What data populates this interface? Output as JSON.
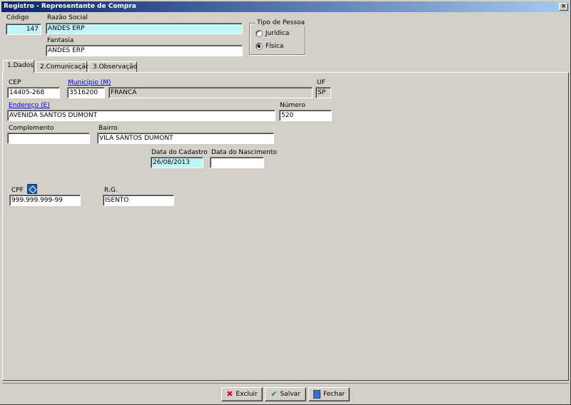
{
  "window": {
    "title": "Registro - Representante de Compra",
    "close": "×"
  },
  "header": {
    "codigo_label": "Código",
    "codigo_value": "147",
    "razao_label": "Razão Social",
    "razao_value": "ANDES ERP",
    "fantasia_label": "Fantasia",
    "fantasia_value": "ANDES ERP",
    "tipo_pessoa": {
      "legend": "Tipo de Pessoa",
      "options": [
        {
          "label": "Jurídica",
          "checked": false
        },
        {
          "label": "Física",
          "checked": true
        }
      ],
      "selected": "Física"
    }
  },
  "tabs": [
    {
      "label": "1.Dados",
      "active": true
    },
    {
      "label": "2.Comunicação",
      "active": false
    },
    {
      "label": "3.Observação",
      "active": false
    }
  ],
  "dados": {
    "cep_label": "CEP",
    "cep_value": "14405-268",
    "municipio_label": "Município (M)",
    "municipio_code": "3516200",
    "municipio_name": "FRANCA",
    "uf_label": "UF",
    "uf_value": "SP",
    "endereco_label": "Endereço (E)",
    "endereco_value": "AVENIDA SANTOS DUMONT",
    "numero_label": "Número",
    "numero_value": "520",
    "complemento_label": "Complemento",
    "complemento_value": "",
    "bairro_label": "Bairro",
    "bairro_value": "VILA SANTOS DUMONT",
    "data_cadastro_label": "Data do Cadastro",
    "data_cadastro_value": "26/08/2013",
    "data_nascimento_label": "Data do Nascimento",
    "data_nascimento_value": "",
    "cpf_label": "CPF",
    "cpf_value": "999.999.999-99",
    "rg_label": "R.G.",
    "rg_value": "ISENTO"
  },
  "buttons": {
    "excluir": "Excluir",
    "salvar": "Salvar",
    "fechar": "Fechar"
  },
  "icons": {
    "excluir": "x-icon",
    "salvar": "check-icon",
    "fechar": "door-exit-icon",
    "cpf": "document-validate-icon"
  },
  "colors": {
    "titlebar_start": "#0a246a",
    "titlebar_end": "#a6caf0",
    "highlight_field": "#bff6fa",
    "link": "#0000ee"
  }
}
